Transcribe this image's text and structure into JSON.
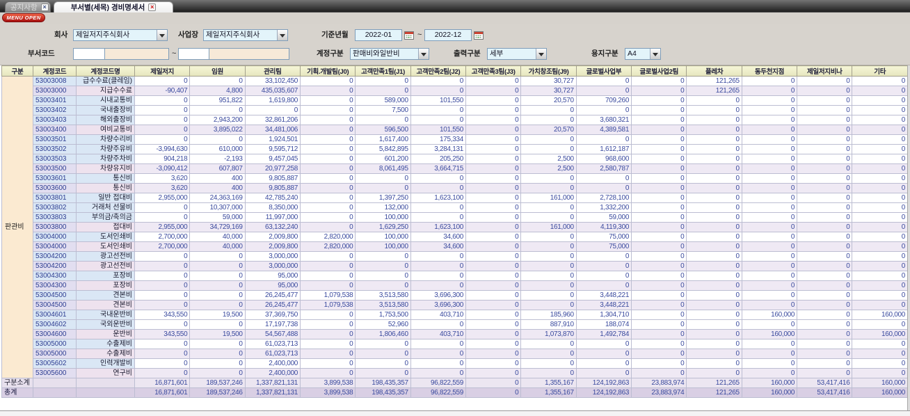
{
  "tabs": [
    {
      "label": "공지사항",
      "active": false
    },
    {
      "label": "부서별(세목) 경비명세서",
      "active": true
    }
  ],
  "menu_button": "MENU OPEN",
  "filters": {
    "company_label": "회사",
    "company_value": "제일저지주식회사",
    "site_label": "사업장",
    "site_value": "제일저지주식회사",
    "period_label": "기준년월",
    "period_from": "2022-01",
    "period_to": "2022-12",
    "range_separator": "~",
    "dept_label": "부서코드",
    "account_label": "계정구분",
    "account_value": "판매비와일반비",
    "output_label": "출력구분",
    "output_value": "세부",
    "paper_label": "용지구분",
    "paper_value": "A4"
  },
  "table": {
    "group_label": "판관비",
    "columns": [
      "구분",
      "계정코드",
      "계정코드명",
      "제일저지",
      "임원",
      "관리팀",
      "기획.개발팀(J0)",
      "고객만족1팀(J1)",
      "고객만족2팀(J2)",
      "고객만족3팀(J3)",
      "가치창조팀(J9)",
      "글로벌사업부",
      "글로벌사업2팀",
      "플레차",
      "동두천지점",
      "제일저지비나",
      "기타"
    ],
    "rows": [
      {
        "code": "53003008",
        "name": "급수수료(클레임)",
        "summary": false,
        "values": [
          "0",
          "0",
          "33,102,450",
          "0",
          "0",
          "0",
          "0",
          "30,727",
          "0",
          "0",
          "121,265",
          "0",
          "0",
          "0"
        ]
      },
      {
        "code": "53003000",
        "name": "지급수수료",
        "summary": true,
        "values": [
          "-90,407",
          "4,800",
          "435,035,607",
          "0",
          "0",
          "0",
          "0",
          "30,727",
          "0",
          "0",
          "121,265",
          "0",
          "0",
          "0"
        ]
      },
      {
        "code": "53003401",
        "name": "시내교통비",
        "summary": false,
        "values": [
          "0",
          "951,822",
          "1,619,800",
          "0",
          "589,000",
          "101,550",
          "0",
          "20,570",
          "709,260",
          "0",
          "0",
          "0",
          "0",
          "0"
        ]
      },
      {
        "code": "53003402",
        "name": "국내출장비",
        "summary": false,
        "values": [
          "0",
          "0",
          "0",
          "0",
          "7,500",
          "0",
          "0",
          "0",
          "0",
          "0",
          "0",
          "0",
          "0",
          "0"
        ]
      },
      {
        "code": "53003403",
        "name": "해외출장비",
        "summary": false,
        "values": [
          "0",
          "2,943,200",
          "32,861,206",
          "0",
          "0",
          "0",
          "0",
          "0",
          "3,680,321",
          "0",
          "0",
          "0",
          "0",
          "0"
        ]
      },
      {
        "code": "53003400",
        "name": "여비교통비",
        "summary": true,
        "values": [
          "0",
          "3,895,022",
          "34,481,006",
          "0",
          "596,500",
          "101,550",
          "0",
          "20,570",
          "4,389,581",
          "0",
          "0",
          "0",
          "0",
          "0"
        ]
      },
      {
        "code": "53003501",
        "name": "차량수리비",
        "summary": false,
        "values": [
          "0",
          "0",
          "1,924,501",
          "0",
          "1,617,400",
          "175,334",
          "0",
          "0",
          "0",
          "0",
          "0",
          "0",
          "0",
          "0"
        ]
      },
      {
        "code": "53003502",
        "name": "차량주유비",
        "summary": false,
        "values": [
          "-3,994,630",
          "610,000",
          "9,595,712",
          "0",
          "5,842,895",
          "3,284,131",
          "0",
          "0",
          "1,612,187",
          "0",
          "0",
          "0",
          "0",
          "0"
        ]
      },
      {
        "code": "53003503",
        "name": "차량주차비",
        "summary": false,
        "values": [
          "904,218",
          "-2,193",
          "9,457,045",
          "0",
          "601,200",
          "205,250",
          "0",
          "2,500",
          "968,600",
          "0",
          "0",
          "0",
          "0",
          "0"
        ]
      },
      {
        "code": "53003500",
        "name": "차량유지비",
        "summary": true,
        "values": [
          "-3,090,412",
          "607,807",
          "20,977,258",
          "0",
          "8,061,495",
          "3,664,715",
          "0",
          "2,500",
          "2,580,787",
          "0",
          "0",
          "0",
          "0",
          "0"
        ]
      },
      {
        "code": "53003601",
        "name": "통신비",
        "summary": false,
        "values": [
          "3,620",
          "400",
          "9,805,887",
          "0",
          "0",
          "0",
          "0",
          "0",
          "0",
          "0",
          "0",
          "0",
          "0",
          "0"
        ]
      },
      {
        "code": "53003600",
        "name": "통신비",
        "summary": true,
        "values": [
          "3,620",
          "400",
          "9,805,887",
          "0",
          "0",
          "0",
          "0",
          "0",
          "0",
          "0",
          "0",
          "0",
          "0",
          "0"
        ]
      },
      {
        "code": "53003801",
        "name": "일반 접대비",
        "summary": false,
        "values": [
          "2,955,000",
          "24,363,169",
          "42,785,240",
          "0",
          "1,397,250",
          "1,623,100",
          "0",
          "161,000",
          "2,728,100",
          "0",
          "0",
          "0",
          "0",
          "0"
        ]
      },
      {
        "code": "53003802",
        "name": "거래처 선물비",
        "summary": false,
        "values": [
          "0",
          "10,307,000",
          "8,350,000",
          "0",
          "132,000",
          "0",
          "0",
          "0",
          "1,332,200",
          "0",
          "0",
          "0",
          "0",
          "0"
        ]
      },
      {
        "code": "53003803",
        "name": "부의금/축의금",
        "summary": false,
        "values": [
          "0",
          "59,000",
          "11,997,000",
          "0",
          "100,000",
          "0",
          "0",
          "0",
          "59,000",
          "0",
          "0",
          "0",
          "0",
          "0"
        ]
      },
      {
        "code": "53003800",
        "name": "접대비",
        "summary": true,
        "values": [
          "2,955,000",
          "34,729,169",
          "63,132,240",
          "0",
          "1,629,250",
          "1,623,100",
          "0",
          "161,000",
          "4,119,300",
          "0",
          "0",
          "0",
          "0",
          "0"
        ]
      },
      {
        "code": "53004000",
        "name": "도서인쇄비",
        "summary": false,
        "values": [
          "2,700,000",
          "40,000",
          "2,009,800",
          "2,820,000",
          "100,000",
          "34,600",
          "0",
          "0",
          "75,000",
          "0",
          "0",
          "0",
          "0",
          "0"
        ]
      },
      {
        "code": "53004000",
        "name": "도서인쇄비",
        "summary": true,
        "values": [
          "2,700,000",
          "40,000",
          "2,009,800",
          "2,820,000",
          "100,000",
          "34,600",
          "0",
          "0",
          "75,000",
          "0",
          "0",
          "0",
          "0",
          "0"
        ]
      },
      {
        "code": "53004200",
        "name": "광고선전비",
        "summary": false,
        "values": [
          "0",
          "0",
          "3,000,000",
          "0",
          "0",
          "0",
          "0",
          "0",
          "0",
          "0",
          "0",
          "0",
          "0",
          "0"
        ]
      },
      {
        "code": "53004200",
        "name": "광고선전비",
        "summary": true,
        "values": [
          "0",
          "0",
          "3,000,000",
          "0",
          "0",
          "0",
          "0",
          "0",
          "0",
          "0",
          "0",
          "0",
          "0",
          "0"
        ]
      },
      {
        "code": "53004300",
        "name": "포장비",
        "summary": false,
        "values": [
          "0",
          "0",
          "95,000",
          "0",
          "0",
          "0",
          "0",
          "0",
          "0",
          "0",
          "0",
          "0",
          "0",
          "0"
        ]
      },
      {
        "code": "53004300",
        "name": "포장비",
        "summary": true,
        "values": [
          "0",
          "0",
          "95,000",
          "0",
          "0",
          "0",
          "0",
          "0",
          "0",
          "0",
          "0",
          "0",
          "0",
          "0"
        ]
      },
      {
        "code": "53004500",
        "name": "견본비",
        "summary": false,
        "values": [
          "0",
          "0",
          "26,245,477",
          "1,079,538",
          "3,513,580",
          "3,696,300",
          "0",
          "0",
          "3,448,221",
          "0",
          "0",
          "0",
          "0",
          "0"
        ]
      },
      {
        "code": "53004500",
        "name": "견본비",
        "summary": true,
        "values": [
          "0",
          "0",
          "26,245,477",
          "1,079,538",
          "3,513,580",
          "3,696,300",
          "0",
          "0",
          "3,448,221",
          "0",
          "0",
          "0",
          "0",
          "0"
        ]
      },
      {
        "code": "53004601",
        "name": "국내운반비",
        "summary": false,
        "values": [
          "343,550",
          "19,500",
          "37,369,750",
          "0",
          "1,753,500",
          "403,710",
          "0",
          "185,960",
          "1,304,710",
          "0",
          "0",
          "160,000",
          "0",
          "160,000"
        ]
      },
      {
        "code": "53004602",
        "name": "국외운반비",
        "summary": false,
        "values": [
          "0",
          "0",
          "17,197,738",
          "0",
          "52,960",
          "0",
          "0",
          "887,910",
          "188,074",
          "0",
          "0",
          "0",
          "0",
          "0"
        ]
      },
      {
        "code": "53004600",
        "name": "운반비",
        "summary": true,
        "values": [
          "343,550",
          "19,500",
          "54,567,488",
          "0",
          "1,806,460",
          "403,710",
          "0",
          "1,073,870",
          "1,492,784",
          "0",
          "0",
          "160,000",
          "0",
          "160,000"
        ]
      },
      {
        "code": "53005000",
        "name": "수출제비",
        "summary": false,
        "values": [
          "0",
          "0",
          "61,023,713",
          "0",
          "0",
          "0",
          "0",
          "0",
          "0",
          "0",
          "0",
          "0",
          "0",
          "0"
        ]
      },
      {
        "code": "53005000",
        "name": "수출제비",
        "summary": true,
        "values": [
          "0",
          "0",
          "61,023,713",
          "0",
          "0",
          "0",
          "0",
          "0",
          "0",
          "0",
          "0",
          "0",
          "0",
          "0"
        ]
      },
      {
        "code": "53005602",
        "name": "인력개발비",
        "summary": false,
        "values": [
          "0",
          "0",
          "2,400,000",
          "0",
          "0",
          "0",
          "0",
          "0",
          "0",
          "0",
          "0",
          "0",
          "0",
          "0"
        ]
      },
      {
        "code": "53005600",
        "name": "연구비",
        "summary": true,
        "values": [
          "0",
          "0",
          "2,400,000",
          "0",
          "0",
          "0",
          "0",
          "0",
          "0",
          "0",
          "0",
          "0",
          "0",
          "0"
        ]
      }
    ],
    "subtotal": {
      "label": "구분소계",
      "values": [
        "16,871,601",
        "189,537,246",
        "1,337,821,131",
        "3,899,538",
        "198,435,357",
        "96,822,559",
        "0",
        "1,355,167",
        "124,192,863",
        "23,883,974",
        "121,265",
        "160,000",
        "53,417,416",
        "160,000"
      ]
    },
    "total": {
      "label": "총계",
      "values": [
        "16,871,601",
        "189,537,246",
        "1,337,821,131",
        "3,899,538",
        "198,435,357",
        "96,822,559",
        "0",
        "1,355,167",
        "124,192,863",
        "23,883,974",
        "121,265",
        "160,000",
        "53,417,416",
        "160,000"
      ]
    }
  },
  "colors": {
    "menu_button_red": "#c41818",
    "header_yellow": "#ececc4",
    "group_cream": "#fbead1",
    "code_blue": "#dae7f5",
    "summary_lavender": "#efe9f4",
    "total_purple": "#d9cfe4",
    "number_navy": "#3a4a9e",
    "input_cyan": "#e3f4fa",
    "input_peach": "#f6e9d8"
  }
}
